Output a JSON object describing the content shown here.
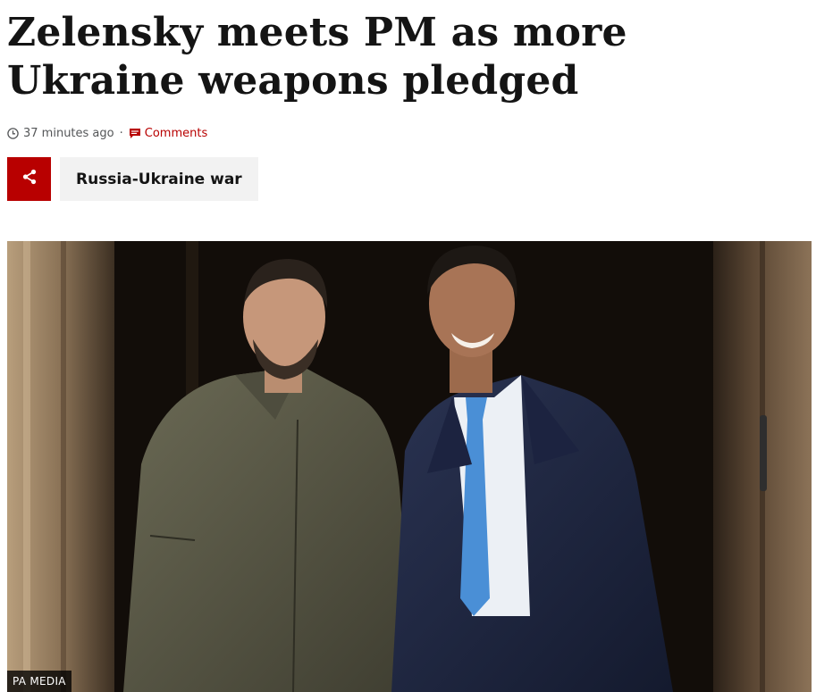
{
  "article": {
    "headline": "Zelensky meets PM as more Ukraine weapons pledged",
    "timestamp": "37 minutes ago",
    "separator": "·",
    "comments_label": "Comments"
  },
  "topic": {
    "label": "Russia-Ukraine war"
  },
  "image": {
    "credit": "PA MEDIA"
  },
  "icons": {
    "timestamp": "clock-icon",
    "comments": "speech-bubble-icon",
    "share": "share-icon"
  },
  "colors": {
    "accent": "#b80000",
    "topic_bg": "#f2f2f2",
    "text": "#141414",
    "meta_text": "#545658"
  }
}
